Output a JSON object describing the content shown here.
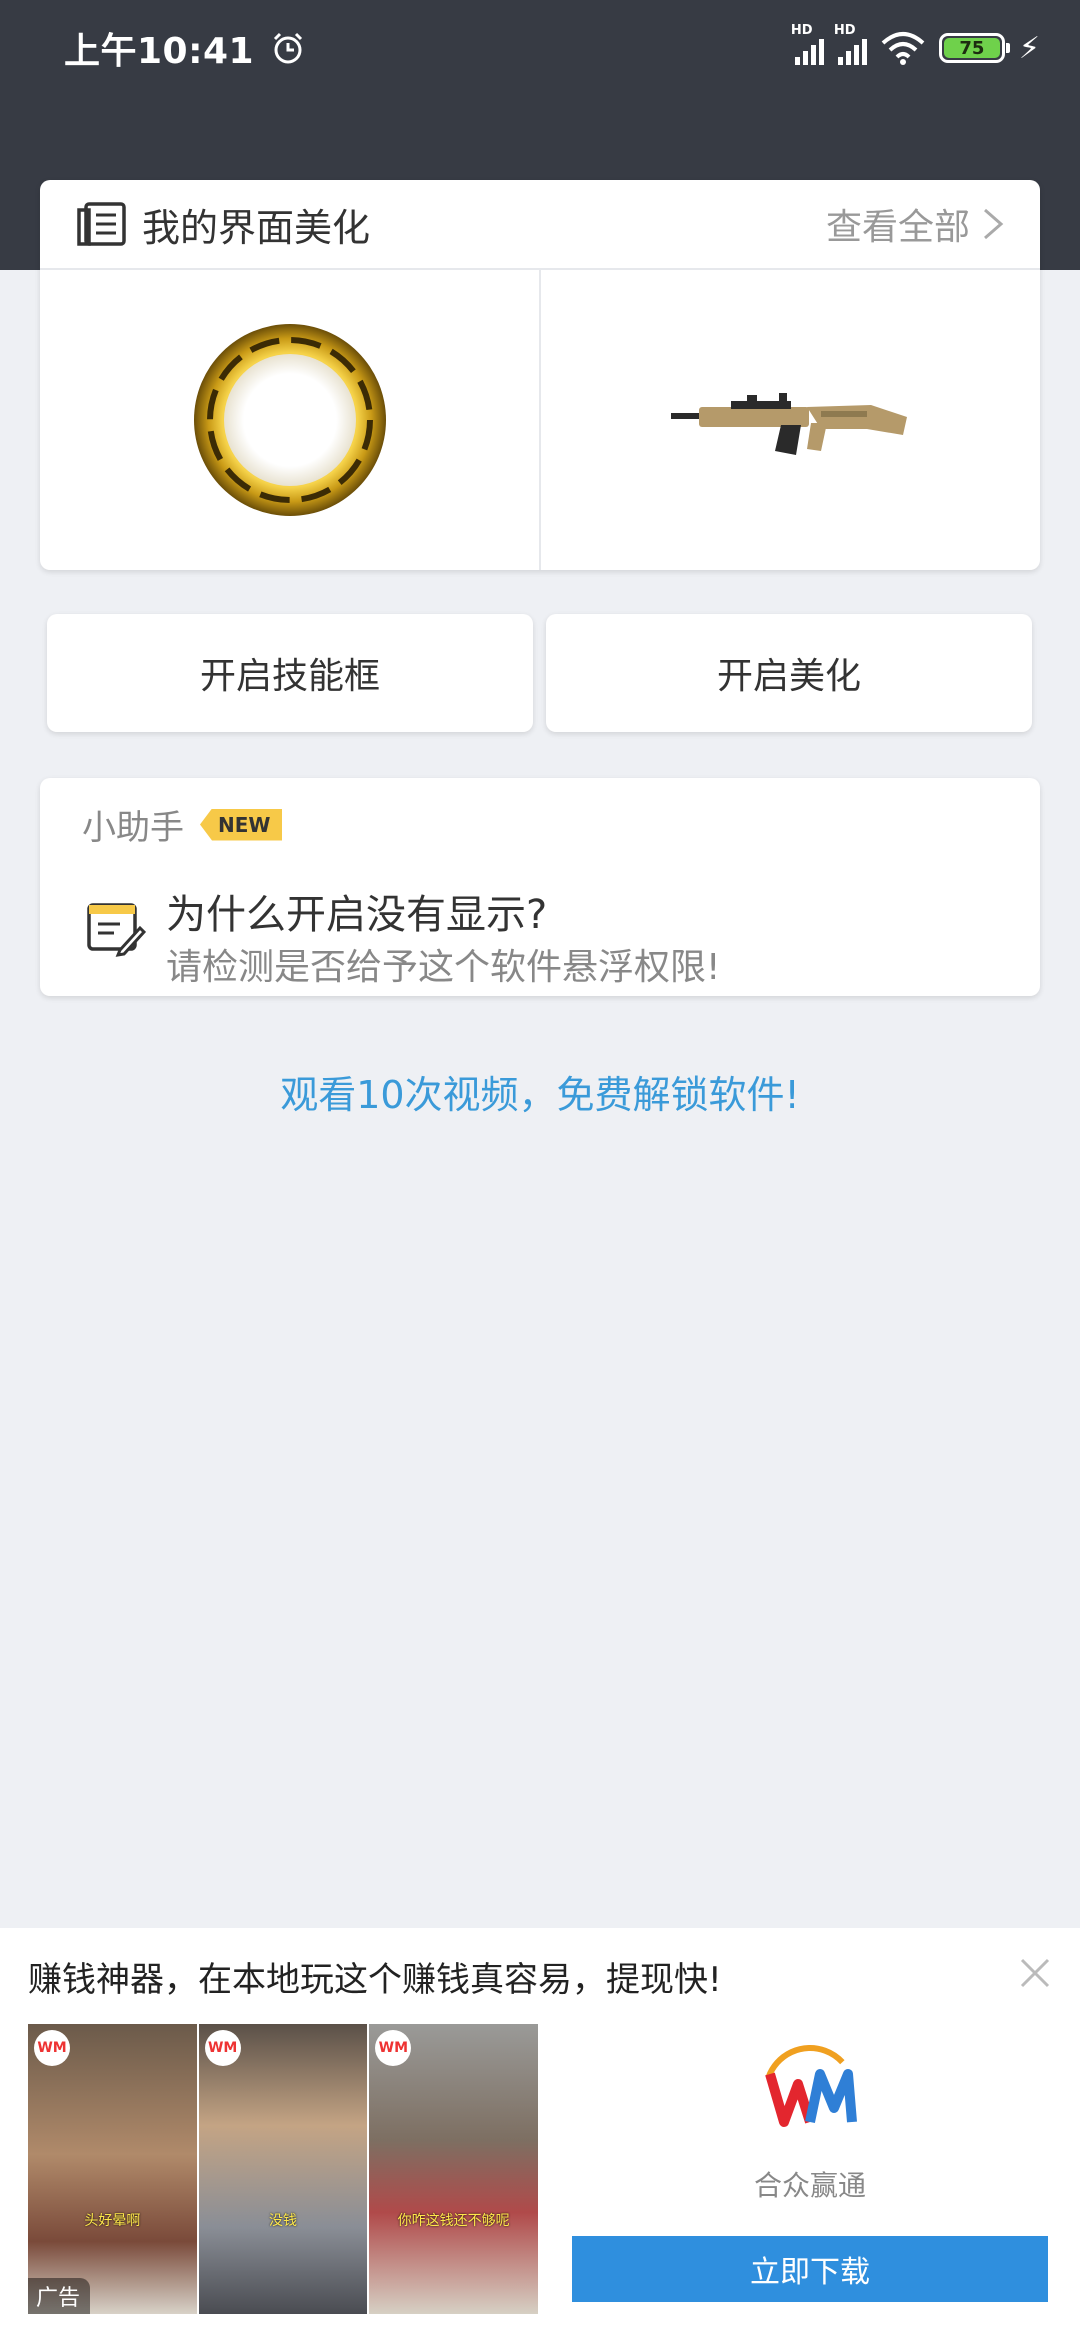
{
  "status_bar": {
    "time": "上午10:41",
    "signal1_label": "HD",
    "signal2_label": "HD",
    "battery": "75"
  },
  "beauty": {
    "title": "我的界面美化",
    "view_all": "查看全部"
  },
  "buttons": {
    "skill": "开启技能框",
    "beauty": "开启美化"
  },
  "helper": {
    "title": "小助手",
    "badge": "NEW",
    "question": "为什么开启没有显示?",
    "answer": "请检测是否给予这个软件悬浮权限!"
  },
  "unlock_text": "观看10次视频，免费解锁软件!",
  "ad": {
    "title": "赚钱神器，在本地玩这个赚钱真容易，提现快!",
    "tag": "广告",
    "brand": "合众赢通",
    "download": "立即下载",
    "subtitle1": "头好晕啊",
    "subtitle2": "没钱",
    "subtitle3": "你咋这钱还不够呢"
  }
}
